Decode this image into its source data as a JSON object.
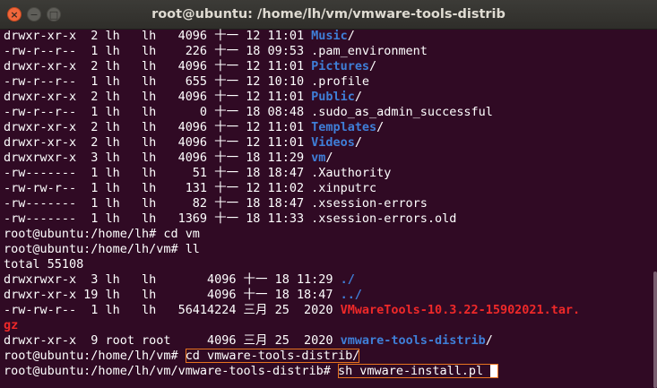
{
  "window": {
    "title": "root@ubuntu: /home/lh/vm/vmware-tools-distrib",
    "buttons": {
      "close": "×",
      "minimize": "−",
      "maximize": "□"
    }
  },
  "colors": {
    "background": "#300a24",
    "directory": "#3f7fd8",
    "archive": "#ef2929",
    "highlight_box": "#e8741f"
  },
  "terminal": {
    "lines": [
      {
        "segments": [
          {
            "text": "drwxr-xr-x  2 lh   lh   4096 十一 12 11:01 ",
            "style": "plain"
          },
          {
            "text": "Music",
            "style": "dir"
          },
          {
            "text": "/",
            "style": "plain"
          }
        ]
      },
      {
        "segments": [
          {
            "text": "-rw-r--r--  1 lh   lh    226 十一 18 09:53 .pam_environment",
            "style": "plain"
          }
        ]
      },
      {
        "segments": [
          {
            "text": "drwxr-xr-x  2 lh   lh   4096 十一 12 11:01 ",
            "style": "plain"
          },
          {
            "text": "Pictures",
            "style": "dir"
          },
          {
            "text": "/",
            "style": "plain"
          }
        ]
      },
      {
        "segments": [
          {
            "text": "-rw-r--r--  1 lh   lh    655 十一 12 10:10 .profile",
            "style": "plain"
          }
        ]
      },
      {
        "segments": [
          {
            "text": "drwxr-xr-x  2 lh   lh   4096 十一 12 11:01 ",
            "style": "plain"
          },
          {
            "text": "Public",
            "style": "dir"
          },
          {
            "text": "/",
            "style": "plain"
          }
        ]
      },
      {
        "segments": [
          {
            "text": "-rw-r--r--  1 lh   lh      0 十一 18 08:48 .sudo_as_admin_successful",
            "style": "plain"
          }
        ]
      },
      {
        "segments": [
          {
            "text": "drwxr-xr-x  2 lh   lh   4096 十一 12 11:01 ",
            "style": "plain"
          },
          {
            "text": "Templates",
            "style": "dir"
          },
          {
            "text": "/",
            "style": "plain"
          }
        ]
      },
      {
        "segments": [
          {
            "text": "drwxr-xr-x  2 lh   lh   4096 十一 12 11:01 ",
            "style": "plain"
          },
          {
            "text": "Videos",
            "style": "dir"
          },
          {
            "text": "/",
            "style": "plain"
          }
        ]
      },
      {
        "segments": [
          {
            "text": "drwxrwxr-x  3 lh   lh   4096 十一 18 11:29 ",
            "style": "plain"
          },
          {
            "text": "vm",
            "style": "dir"
          },
          {
            "text": "/",
            "style": "plain"
          }
        ]
      },
      {
        "segments": [
          {
            "text": "-rw-------  1 lh   lh     51 十一 18 18:47 .Xauthority",
            "style": "plain"
          }
        ]
      },
      {
        "segments": [
          {
            "text": "-rw-rw-r--  1 lh   lh    131 十一 12 11:02 .xinputrc",
            "style": "plain"
          }
        ]
      },
      {
        "segments": [
          {
            "text": "-rw-------  1 lh   lh     82 十一 18 18:47 .xsession-errors",
            "style": "plain"
          }
        ]
      },
      {
        "segments": [
          {
            "text": "-rw-------  1 lh   lh   1369 十一 18 11:33 .xsession-errors.old",
            "style": "plain"
          }
        ]
      },
      {
        "segments": [
          {
            "text": "root@ubuntu:/home/lh# cd vm",
            "style": "plain"
          }
        ]
      },
      {
        "segments": [
          {
            "text": "root@ubuntu:/home/lh/vm# ll",
            "style": "plain"
          }
        ]
      },
      {
        "segments": [
          {
            "text": "total 55108",
            "style": "plain"
          }
        ]
      },
      {
        "segments": [
          {
            "text": "drwxrwxr-x  3 lh   lh       4096 十一 18 11:29 ",
            "style": "plain"
          },
          {
            "text": "./",
            "style": "dir"
          }
        ]
      },
      {
        "segments": [
          {
            "text": "drwxr-xr-x 19 lh   lh       4096 十一 18 18:47 ",
            "style": "plain"
          },
          {
            "text": "../",
            "style": "dir"
          }
        ]
      },
      {
        "segments": [
          {
            "text": "-rw-rw-r--  1 lh   lh   56414224 三月 25  2020 ",
            "style": "plain"
          },
          {
            "text": "VMwareTools-10.3.22-15902021.tar.",
            "style": "arch"
          }
        ]
      },
      {
        "segments": [
          {
            "text": "gz",
            "style": "arch"
          }
        ]
      },
      {
        "segments": [
          {
            "text": "drwxr-xr-x  9 root root     4096 三月 25  2020 ",
            "style": "plain"
          },
          {
            "text": "vmware-tools-distrib",
            "style": "dir"
          },
          {
            "text": "/",
            "style": "plain"
          }
        ]
      },
      {
        "segments": [
          {
            "text": "root@ubuntu:/home/lh/vm# ",
            "style": "plain"
          },
          {
            "text": "cd vmware-tools-distrib/",
            "style": "hl"
          }
        ]
      },
      {
        "segments": [
          {
            "text": "root@ubuntu:/home/lh/vm/vmware-tools-distrib# ",
            "style": "plain"
          },
          {
            "text": "sh vmware-install.pl ",
            "style": "hl",
            "cursor": true
          }
        ]
      }
    ]
  }
}
